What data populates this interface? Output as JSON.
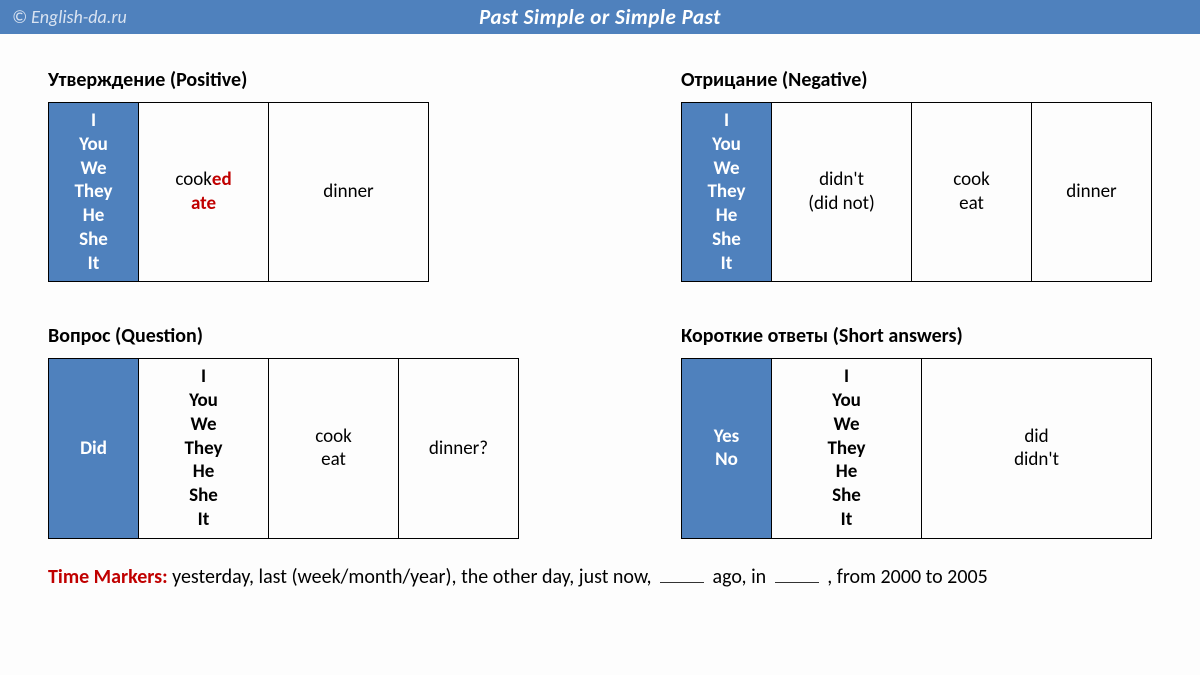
{
  "header": {
    "site": "© English-da.ru",
    "title": "Past Simple or Simple Past"
  },
  "positive": {
    "title": "Утверждение (Positive)",
    "subjects": [
      "I",
      "You",
      "We",
      "They",
      "He",
      "She",
      "It"
    ],
    "verb_cook_base": "cook",
    "verb_cook_suffix": "ed",
    "verb_ate": "ate",
    "object": "dinner"
  },
  "negative": {
    "title": "Отрицание (Negative)",
    "subjects": [
      "I",
      "You",
      "We",
      "They",
      "He",
      "She",
      "It"
    ],
    "aux1": "didn't",
    "aux2": "(did not)",
    "verb1": "cook",
    "verb2": "eat",
    "object": "dinner"
  },
  "question": {
    "title": "Вопрос (Question)",
    "aux": "Did",
    "subjects": [
      "I",
      "You",
      "We",
      "They",
      "He",
      "She",
      "It"
    ],
    "verb1": "cook",
    "verb2": "eat",
    "object": "dinner?"
  },
  "short": {
    "title": "Короткие ответы (Short answers)",
    "yes": "Yes",
    "no": "No",
    "subjects": [
      "I",
      "You",
      "We",
      "They",
      "He",
      "She",
      "It"
    ],
    "ans1": "did",
    "ans2": "didn't"
  },
  "markers": {
    "label": "Time Markers:",
    "m1": "yesterday, last (week/month/year), the other day, just now,",
    "m2": "ago, in",
    "m3": ", from 2000 to 2005"
  }
}
